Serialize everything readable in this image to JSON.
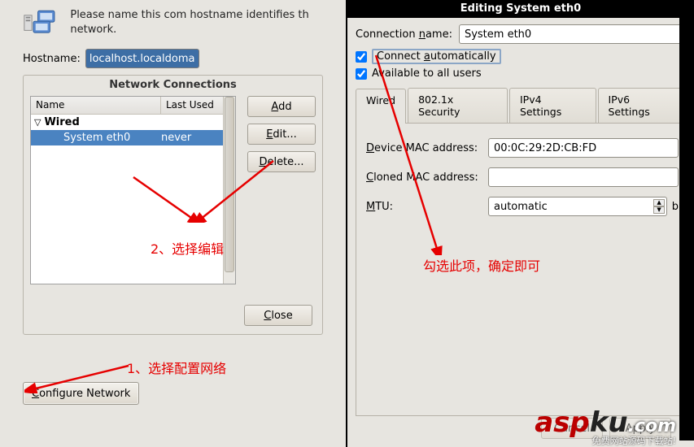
{
  "info_text": "Please name this com hostname identifies th network.",
  "hostname": {
    "label": "Hostname:",
    "value": "localhost.localdomain"
  },
  "nc": {
    "title": "Network Connections",
    "headers": {
      "name": "Name",
      "last": "Last Used"
    },
    "group": "Wired",
    "row": {
      "name": "System eth0",
      "last": "never"
    },
    "buttons": {
      "add": "Add",
      "edit": "Edit...",
      "delete": "Delete...",
      "close": "Close"
    }
  },
  "config_btn": "Configure Network",
  "edit_dialog": {
    "title": "Editing System eth0",
    "conn_label": "Connection name:",
    "conn_value": "System eth0",
    "chk1": "Connect automatically",
    "chk2": "Available to all users",
    "tabs": [
      "Wired",
      "802.1x Security",
      "IPv4 Settings",
      "IPv6 Settings"
    ],
    "devmac_label": "Device MAC address:",
    "devmac_value": "00:0C:29:2D:CB:FD",
    "clmac_label": "Cloned MAC address:",
    "clmac_value": "",
    "mtu_label": "MTU:",
    "mtu_value": "automatic",
    "mtu_unit": "b",
    "cancel": "Cancel",
    "apply": "Apply"
  },
  "annotations": {
    "a1": "1、选择配置网络",
    "a2": "2、选择编辑",
    "a3": "勾选此项，确定即可"
  },
  "watermark": {
    "brand_a": "asp",
    "brand_b": "ku",
    "dot": ".com",
    "sub": "免费网站源码下载站!"
  }
}
